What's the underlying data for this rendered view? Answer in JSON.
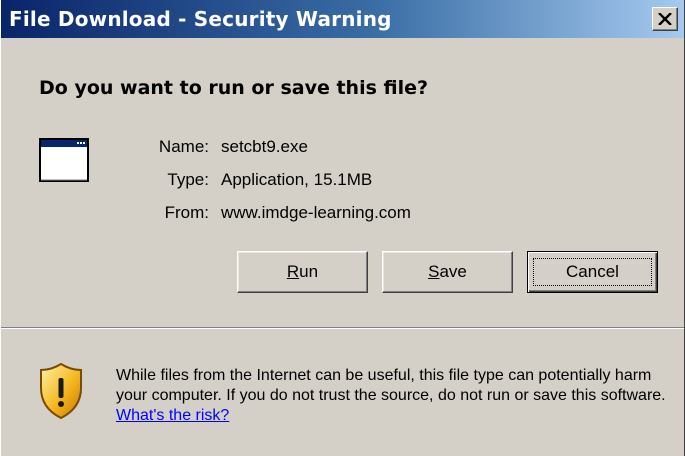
{
  "window": {
    "title": "File Download - Security Warning"
  },
  "dialog": {
    "question": "Do you want to run or save this file?",
    "file": {
      "name_label": "Name:",
      "name_value": "setcbt9.exe",
      "type_label": "Type:",
      "type_value": "Application, 15.1MB",
      "from_label": "From:",
      "from_value": "www.imdge-learning.com"
    },
    "buttons": {
      "run_accel": "R",
      "run_rest": "un",
      "save_accel": "S",
      "save_rest": "ave",
      "cancel": "Cancel"
    },
    "warning": {
      "text": "While files from the Internet can be useful, this file type can potentially harm your computer. If you do not trust the source, do not run or save this software. ",
      "link": "What's the risk?"
    }
  },
  "icons": {
    "close": "close-icon",
    "application": "application-icon",
    "security": "shield-warning-icon"
  },
  "colors": {
    "titlebar_start": "#0a246a",
    "titlebar_end": "#a6caf0",
    "dialog_face": "#d4d0c8",
    "link": "#0000ff"
  }
}
